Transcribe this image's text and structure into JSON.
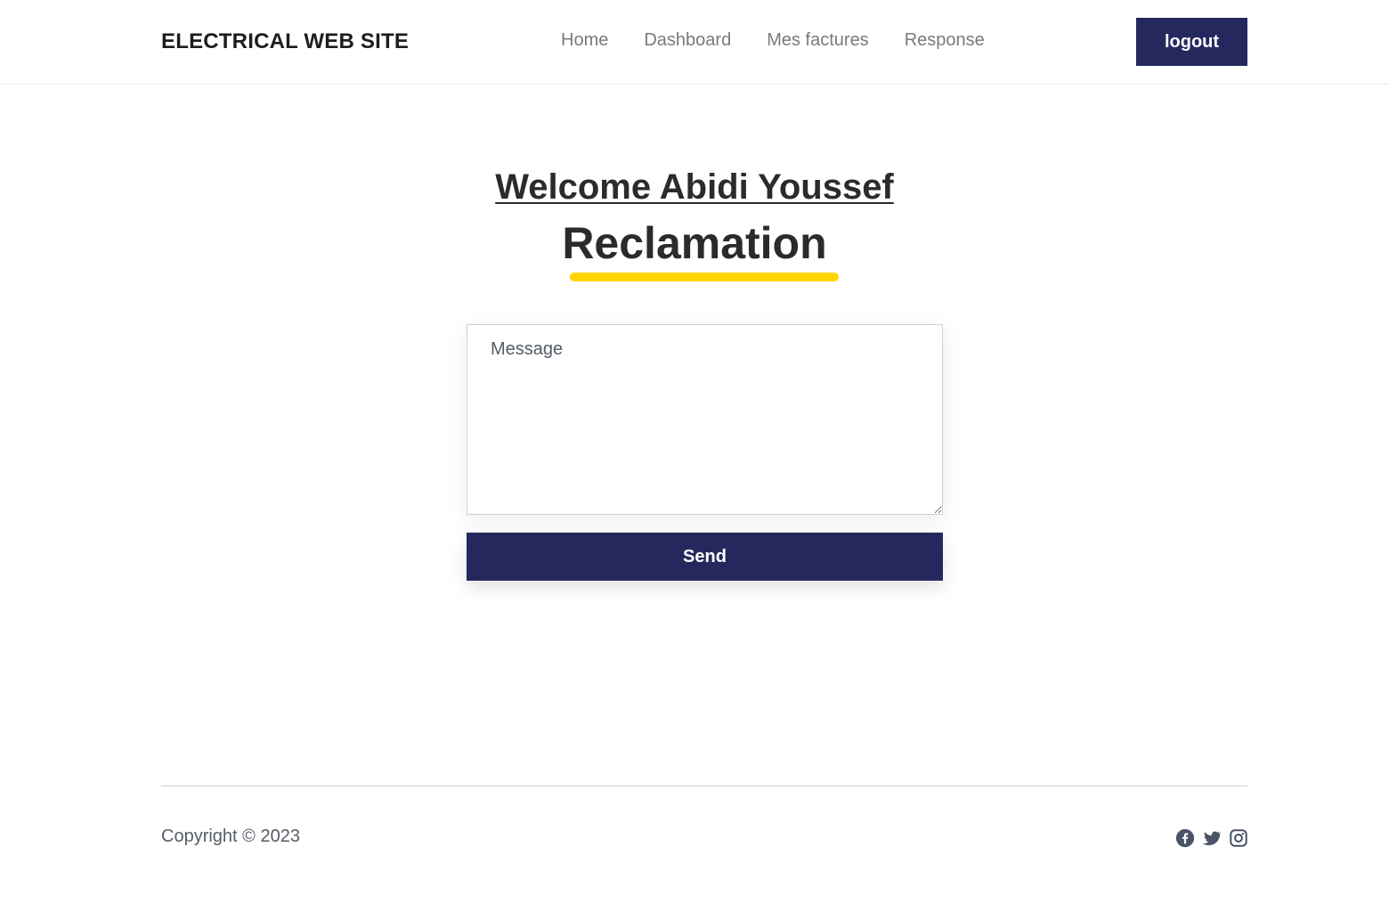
{
  "header": {
    "brand": "ELECTRICAL WEB SITE",
    "nav": [
      {
        "label": "Home"
      },
      {
        "label": "Dashboard"
      },
      {
        "label": "Mes factures"
      },
      {
        "label": "Response"
      }
    ],
    "logout_label": "logout"
  },
  "main": {
    "welcome": "Welcome Abidi Youssef",
    "title": "Reclamation",
    "message_placeholder": "Message",
    "message_value": "",
    "send_label": "Send"
  },
  "footer": {
    "copyright": "Copyright © 2023",
    "socials": [
      "facebook-icon",
      "twitter-icon",
      "instagram-icon"
    ]
  },
  "colors": {
    "primary": "#25285d",
    "accent": "#ffd500",
    "text": "#2b2b2b",
    "muted": "#7a7a7a"
  }
}
